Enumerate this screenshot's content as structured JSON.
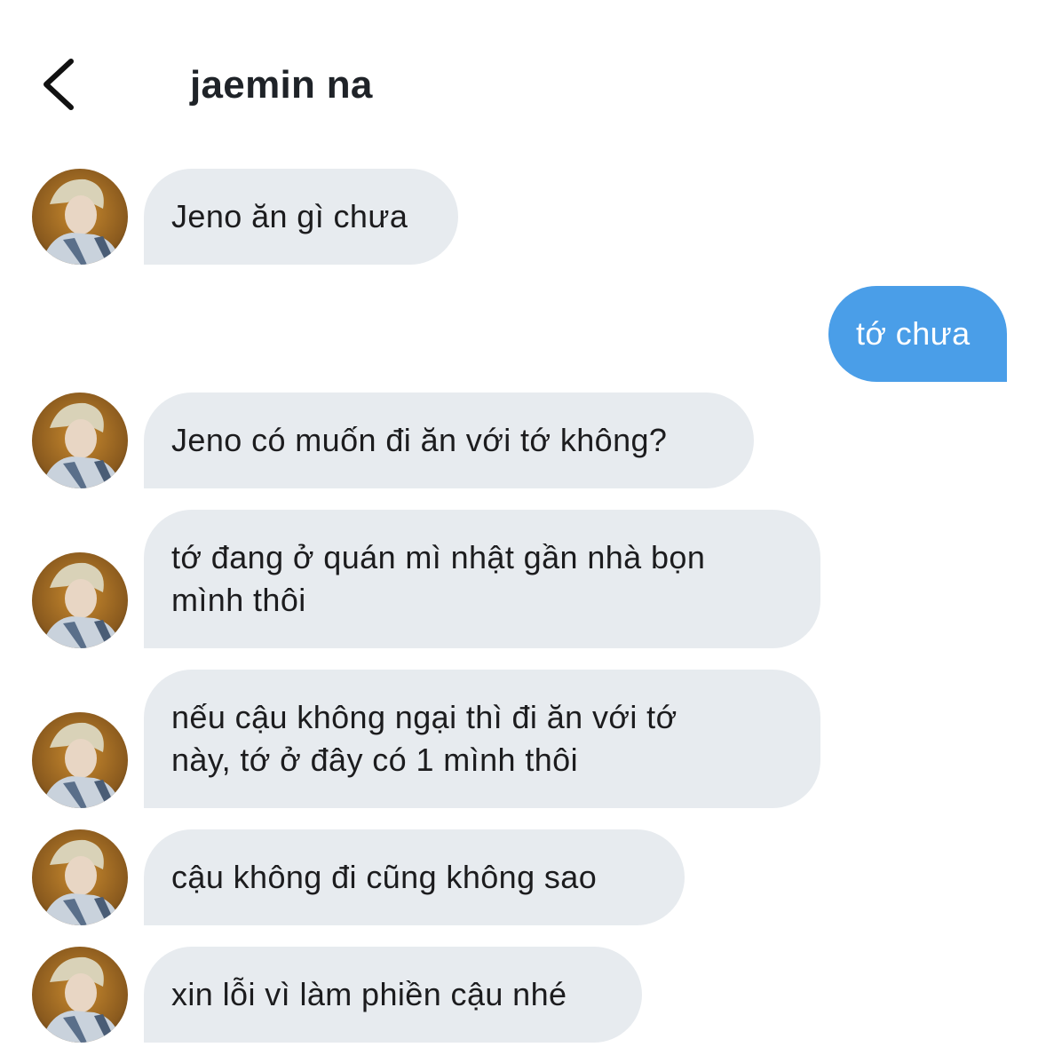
{
  "header": {
    "title": "jaemin na"
  },
  "messages": [
    {
      "direction": "in",
      "text": "Jeno ăn gì chưa"
    },
    {
      "direction": "out",
      "text": "tớ chưa"
    },
    {
      "direction": "in",
      "text": "Jeno có muốn đi ăn với tớ không?"
    },
    {
      "direction": "in",
      "text": "tớ đang ở quán mì nhật gần nhà bọn\nmình thôi"
    },
    {
      "direction": "in",
      "text": "nếu cậu không ngại thì đi ăn với tớ\nnày, tớ ở đây có 1 mình thôi"
    },
    {
      "direction": "in",
      "text": "cậu không đi cũng không sao"
    },
    {
      "direction": "in",
      "text": "xin lỗi vì làm phiền cậu nhé"
    }
  ],
  "colors": {
    "incoming_bubble": "#e7ebef",
    "outgoing_bubble": "#4a9ee8",
    "text": "#1c1c1e",
    "outgoing_text": "#ffffff"
  },
  "icons": {
    "back": "chevron-left-icon",
    "avatar": "profile-photo"
  }
}
